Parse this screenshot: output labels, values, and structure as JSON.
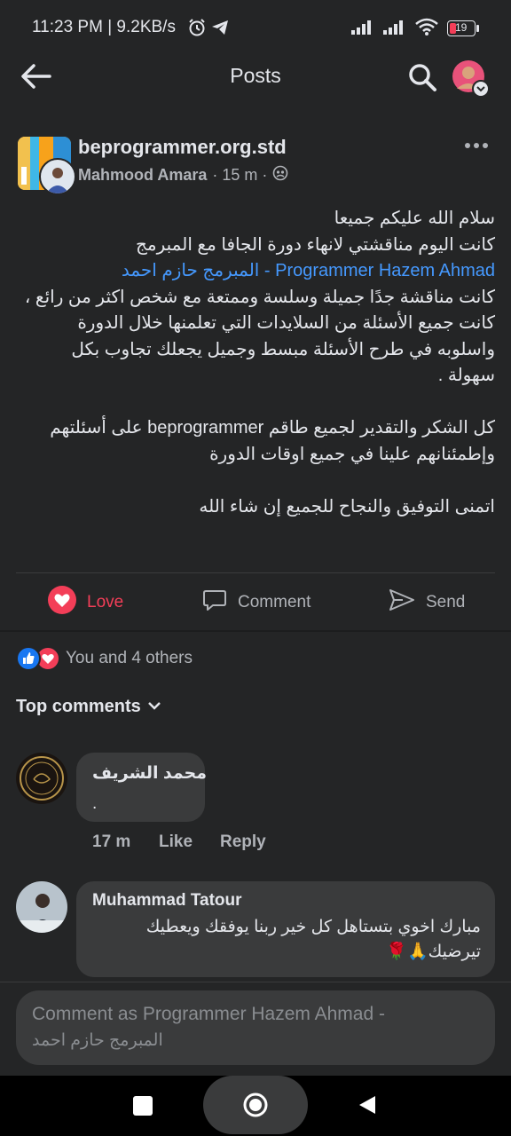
{
  "status_bar": {
    "time_speed": "11:23 PM | 9.2KB/s",
    "battery": "19"
  },
  "header": {
    "title": "Posts"
  },
  "post": {
    "page_name": "beprogrammer.org.std",
    "author": "Mahmood Amara",
    "time": "· 15 m ·",
    "line1": "سلام الله عليكم جميعا",
    "line2": "كانت اليوم مناقشتي لانهاء دورة الجافا مع المبرمج",
    "mention": "Programmer Hazem Ahmad - المبرمج حازم احمد",
    "line3": "كانت مناقشة جدًا جميلة وسلسة وممتعة مع شخص اكثر من رائع ،",
    "line4": "كانت جميع الأسئلة من السلايدات التي تعلمنها خلال الدورة",
    "line5": "واسلوبه في طرح الأسئلة مبسط وجميل يجعلك تجاوب بكل",
    "line6": "سهولة .",
    "line7": "كل الشكر والتقدير لجميع طاقم beprogrammer على أسئلتهم",
    "line8": "وإطمئنانهم علينا في جميع اوقات الدورة",
    "line9": "اتمنى التوفيق والنجاح للجميع إن شاء الله"
  },
  "actions": {
    "love": "Love",
    "comment": "Comment",
    "send": "Send"
  },
  "reactions": {
    "summary": "You and 4 others"
  },
  "comments_section": {
    "sort_label": "Top comments"
  },
  "comments": [
    {
      "author": "محمد الشريف",
      "text": ".",
      "time": "17 m",
      "like": "Like",
      "reply": "Reply"
    },
    {
      "author": "Muhammad Tatour",
      "text_line1": "مبارك اخوي بتستاهل كل خير ربنا يوفقك ويعطيك",
      "text_line2": "تيرضيك🙏🌹"
    }
  ],
  "composer": {
    "line1": "Comment as Programmer Hazem Ahmad -",
    "line2": "المبرمج حازم احمد"
  },
  "colors": {
    "background": "#242526",
    "bubble": "#3a3b3c",
    "link": "#4599ff",
    "love": "#f33e58",
    "like_blue": "#1877f2"
  }
}
